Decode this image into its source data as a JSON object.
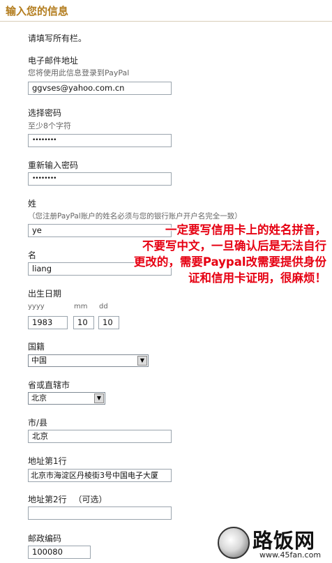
{
  "header": {
    "title": "输入您的信息"
  },
  "form": {
    "instruction": "请填写所有栏。",
    "email": {
      "label": "电子邮件地址",
      "hint": "您将使用此信息登录到PayPal",
      "value": "ggvses@yahoo.com.cn"
    },
    "password": {
      "label": "选择密码",
      "hint": "至少8个字符",
      "value": "••••••••"
    },
    "confirm_password": {
      "label": "重新输入密码",
      "value": "••••••••"
    },
    "last_name": {
      "label": "姓",
      "hint": "（您注册PayPal账户的姓名必须与您的银行账户开户名完全一致）",
      "value": "ye"
    },
    "first_name": {
      "label": "名",
      "value": "liang"
    },
    "birthday": {
      "label": "出生日期",
      "year_label": "yyyy",
      "month_label": "mm",
      "day_label": "dd",
      "year": "1983",
      "month": "10",
      "day": "10"
    },
    "nationality": {
      "label": "国籍",
      "value": "中国"
    },
    "province": {
      "label": "省或直辖市",
      "value": "北京"
    },
    "city": {
      "label": "市/县",
      "value": "北京"
    },
    "address1": {
      "label": "地址第1行",
      "value": "北京市海淀区丹棱街3号中国电子大厦"
    },
    "address2": {
      "label": "地址第2行",
      "optional": "（可选）",
      "value": ""
    },
    "postcode": {
      "label": "邮政编码",
      "value": "100080"
    }
  },
  "annotation": {
    "lines": [
      "一定要写信用卡上的姓名拼音，",
      "不要写中文，一旦确认后是无法自行",
      "更改的，需要Paypal改需要提供身份",
      "证和信用卡证明，很麻烦！"
    ],
    "color": "#e60012"
  },
  "watermark": {
    "name": "路饭网",
    "url": "www.45fan.com",
    "icon": "disc-logo-icon"
  }
}
